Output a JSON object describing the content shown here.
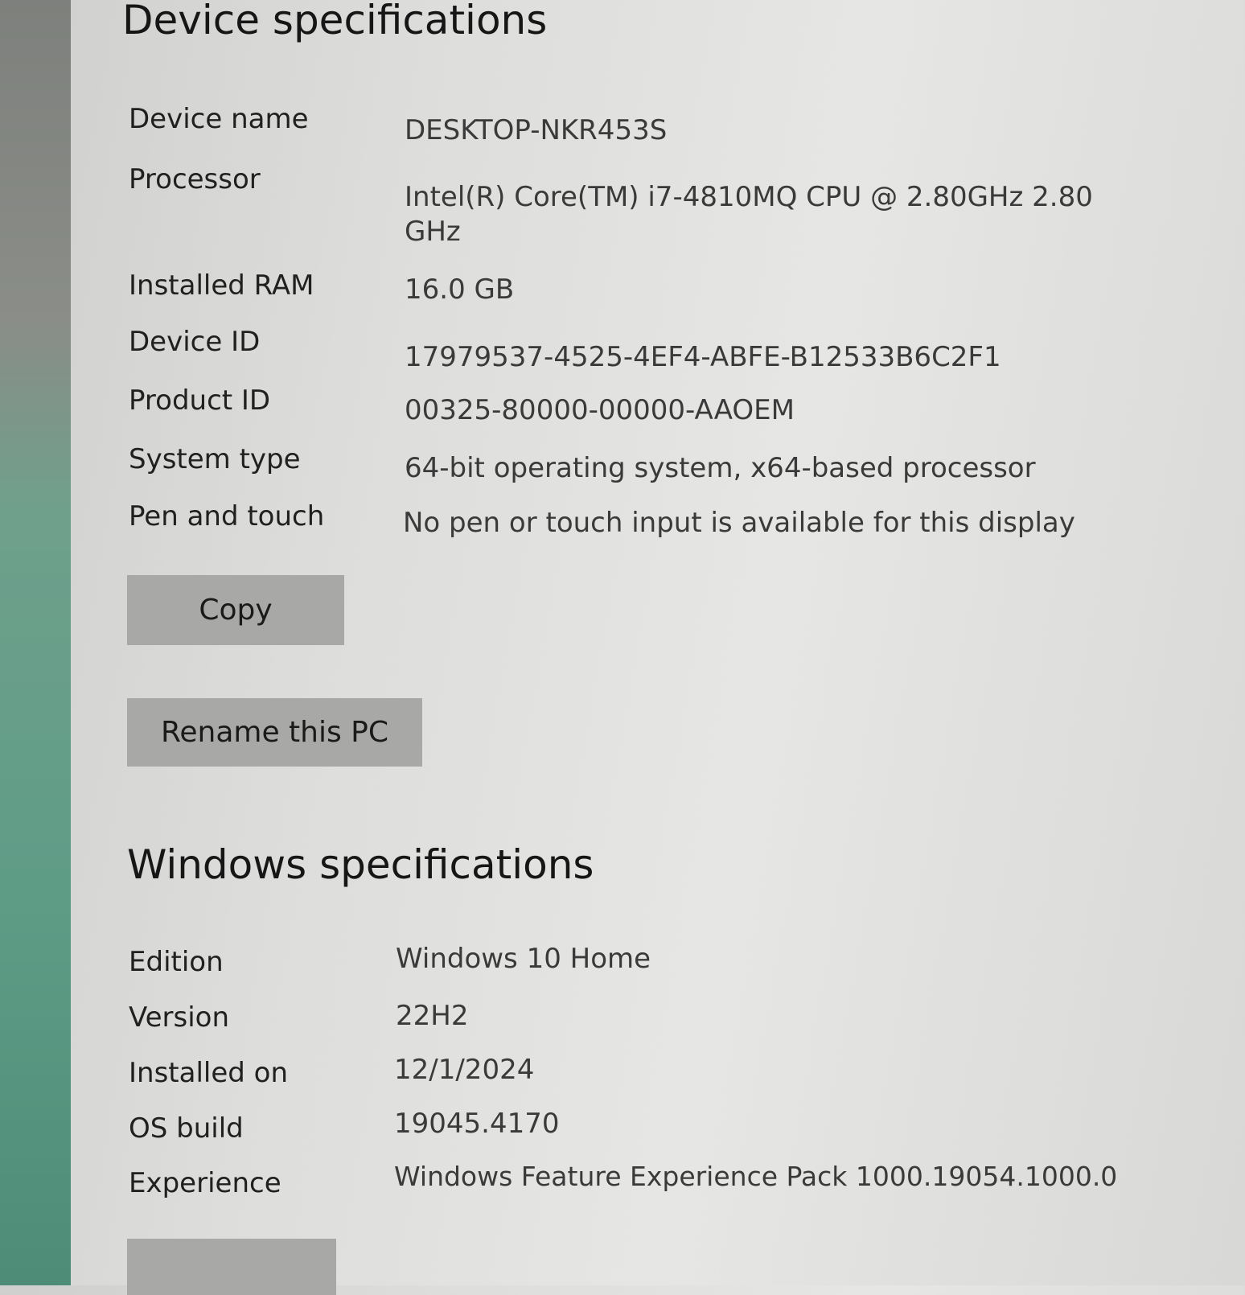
{
  "device_specs": {
    "title": "Device specifications",
    "rows": [
      {
        "label": "Device name",
        "value": "DESKTOP-NKR453S"
      },
      {
        "label": "Processor",
        "value": "Intel(R) Core(TM) i7-4810MQ CPU @ 2.80GHz   2.80",
        "value2": "GHz"
      },
      {
        "label": "Installed RAM",
        "value": "16.0 GB"
      },
      {
        "label": "Device ID",
        "value": "17979537-4525-4EF4-ABFE-B12533B6C2F1"
      },
      {
        "label": "Product ID",
        "value": "00325-80000-00000-AAOEM"
      },
      {
        "label": "System type",
        "value": "64-bit operating system, x64-based processor"
      },
      {
        "label": "Pen and touch",
        "value": "No pen or touch input is available for this display"
      }
    ],
    "copy_label": "Copy",
    "rename_label": "Rename this PC"
  },
  "windows_specs": {
    "title": "Windows specifications",
    "rows": [
      {
        "label": "Edition",
        "value": "Windows 10 Home"
      },
      {
        "label": "Version",
        "value": "22H2"
      },
      {
        "label": "Installed on",
        "value": "12/1/2024"
      },
      {
        "label": "OS build",
        "value": "19045.4170"
      },
      {
        "label": "Experience",
        "value": "Windows Feature Experience Pack 1000.19054.1000.0"
      }
    ]
  }
}
